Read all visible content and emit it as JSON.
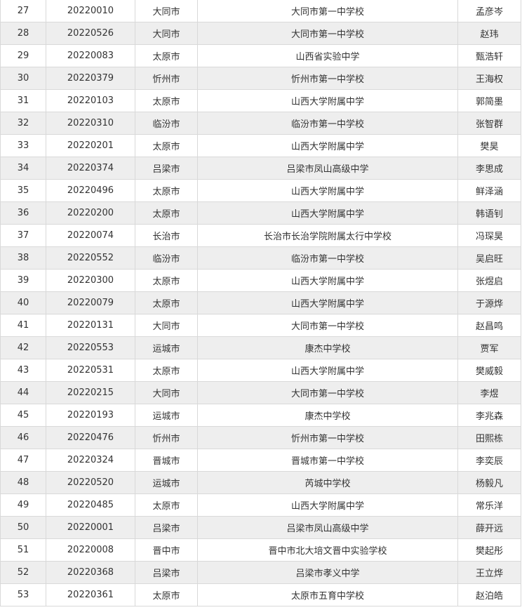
{
  "table": {
    "rows": [
      {
        "rank": "27",
        "id": "20220010",
        "city": "大同市",
        "school": "大同市第一中学校",
        "name": "孟彦岑"
      },
      {
        "rank": "28",
        "id": "20220526",
        "city": "大同市",
        "school": "大同市第一中学校",
        "name": "赵玮"
      },
      {
        "rank": "29",
        "id": "20220083",
        "city": "太原市",
        "school": "山西省实验中学",
        "name": "甄浩轩"
      },
      {
        "rank": "30",
        "id": "20220379",
        "city": "忻州市",
        "school": "忻州市第一中学校",
        "name": "王海权"
      },
      {
        "rank": "31",
        "id": "20220103",
        "city": "太原市",
        "school": "山西大学附属中学",
        "name": "郭简墨"
      },
      {
        "rank": "32",
        "id": "20220310",
        "city": "临汾市",
        "school": "临汾市第一中学校",
        "name": "张智群"
      },
      {
        "rank": "33",
        "id": "20220201",
        "city": "太原市",
        "school": "山西大学附属中学",
        "name": "樊昊"
      },
      {
        "rank": "34",
        "id": "20220374",
        "city": "吕梁市",
        "school": "吕梁市凤山高级中学",
        "name": "李思成"
      },
      {
        "rank": "35",
        "id": "20220496",
        "city": "太原市",
        "school": "山西大学附属中学",
        "name": "鲜泽涵"
      },
      {
        "rank": "36",
        "id": "20220200",
        "city": "太原市",
        "school": "山西大学附属中学",
        "name": "韩语钊"
      },
      {
        "rank": "37",
        "id": "20220074",
        "city": "长治市",
        "school": "长治市长治学院附属太行中学校",
        "name": "冯琛昊"
      },
      {
        "rank": "38",
        "id": "20220552",
        "city": "临汾市",
        "school": "临汾市第一中学校",
        "name": "吴启旺"
      },
      {
        "rank": "39",
        "id": "20220300",
        "city": "太原市",
        "school": "山西大学附属中学",
        "name": "张煜启"
      },
      {
        "rank": "40",
        "id": "20220079",
        "city": "太原市",
        "school": "山西大学附属中学",
        "name": "于源烨"
      },
      {
        "rank": "41",
        "id": "20220131",
        "city": "大同市",
        "school": "大同市第一中学校",
        "name": "赵昌鸣"
      },
      {
        "rank": "42",
        "id": "20220553",
        "city": "运城市",
        "school": "康杰中学校",
        "name": "贾军"
      },
      {
        "rank": "43",
        "id": "20220531",
        "city": "太原市",
        "school": "山西大学附属中学",
        "name": "樊威毅"
      },
      {
        "rank": "44",
        "id": "20220215",
        "city": "大同市",
        "school": "大同市第一中学校",
        "name": "李煜"
      },
      {
        "rank": "45",
        "id": "20220193",
        "city": "运城市",
        "school": "康杰中学校",
        "name": "李兆森"
      },
      {
        "rank": "46",
        "id": "20220476",
        "city": "忻州市",
        "school": "忻州市第一中学校",
        "name": "田熙栋"
      },
      {
        "rank": "47",
        "id": "20220324",
        "city": "晋城市",
        "school": "晋城市第一中学校",
        "name": "李奕辰"
      },
      {
        "rank": "48",
        "id": "20220520",
        "city": "运城市",
        "school": "芮城中学校",
        "name": "杨毅凡"
      },
      {
        "rank": "49",
        "id": "20220485",
        "city": "太原市",
        "school": "山西大学附属中学",
        "name": "常乐洋"
      },
      {
        "rank": "50",
        "id": "20220001",
        "city": "吕梁市",
        "school": "吕梁市凤山高级中学",
        "name": "薛开远"
      },
      {
        "rank": "51",
        "id": "20220008",
        "city": "晋中市",
        "school": "晋中市北大培文晋中实验学校",
        "name": "樊起彤"
      },
      {
        "rank": "52",
        "id": "20220368",
        "city": "吕梁市",
        "school": "吕梁市孝义中学",
        "name": "王立烨"
      },
      {
        "rank": "53",
        "id": "20220361",
        "city": "太原市",
        "school": "太原市五育中学校",
        "name": "赵泊皓"
      }
    ]
  }
}
